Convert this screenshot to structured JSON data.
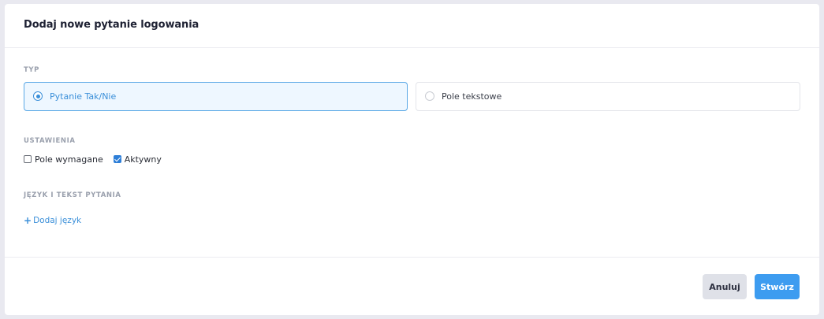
{
  "dialog": {
    "title": "Dodaj nowe pytanie logowania"
  },
  "type_section": {
    "label": "TYP",
    "options": [
      {
        "label": "Pytanie Tak/Nie",
        "selected": true
      },
      {
        "label": "Pole tekstowe",
        "selected": false
      }
    ]
  },
  "settings_section": {
    "label": "USTAWIENIA",
    "required": {
      "label": "Pole wymagane",
      "checked": false
    },
    "active": {
      "label": "Aktywny",
      "checked": true
    }
  },
  "language_section": {
    "label": "JĘZYK I TEKST PYTANIA",
    "add_icon": "+",
    "add_label": "Dodaj język"
  },
  "footer": {
    "cancel_label": "Anuluj",
    "create_label": "Stwórz"
  },
  "colors": {
    "accent": "#3a8fd9",
    "primary_button": "#3d9cf0",
    "cancel_button": "#dfe1e8",
    "selected_bg": "#eef7ff"
  }
}
